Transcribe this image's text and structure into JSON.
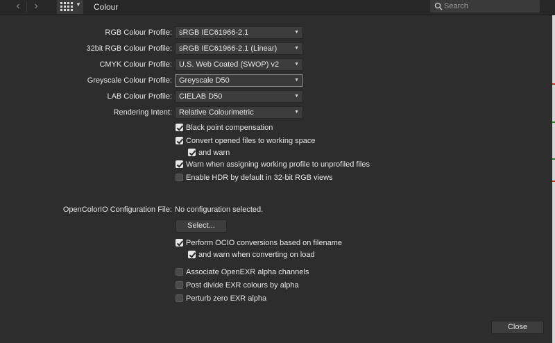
{
  "titlebar": {
    "title": "Colour",
    "search_placeholder": "Search",
    "back_icon": "chevron-left",
    "forward_icon": "chevron-right",
    "grid_icon": "grid-view"
  },
  "profiles": [
    {
      "label": "RGB Colour Profile:",
      "value": "sRGB IEC61966-2.1"
    },
    {
      "label": "32bit RGB Colour Profile:",
      "value": "sRGB IEC61966-2.1 (Linear)"
    },
    {
      "label": "CMYK Colour Profile:",
      "value": "U.S. Web Coated (SWOP) v2"
    },
    {
      "label": "Greyscale Colour Profile:",
      "value": "Greyscale D50"
    },
    {
      "label": "LAB Colour Profile:",
      "value": "CIELAB D50"
    },
    {
      "label": "Rendering Intent:",
      "value": "Relative Colourimetric"
    }
  ],
  "checks": [
    {
      "label": "Black point compensation",
      "checked": true
    },
    {
      "label": "Convert opened files to working space",
      "checked": true
    },
    {
      "label": "and warn",
      "checked": true
    },
    {
      "label": "Warn when assigning working profile to unprofiled files",
      "checked": true
    },
    {
      "label": "Enable HDR by default in 32-bit RGB views",
      "checked": false
    }
  ],
  "ocio": {
    "label": "OpenColorIO Configuration File:",
    "value": "No configuration selected.",
    "select_button": "Select...",
    "checks": [
      {
        "label": "Perform OCIO conversions based on filename",
        "checked": true
      },
      {
        "label": "and warn when converting on load",
        "checked": true
      },
      {
        "label": "Associate OpenEXR alpha channels",
        "checked": false
      },
      {
        "label": "Post divide EXR colours by alpha",
        "checked": false
      },
      {
        "label": "Perturb zero EXR alpha",
        "checked": false
      }
    ]
  },
  "footer": {
    "close_button": "Close"
  },
  "colors": {
    "background": "#2d2d2d",
    "titlebar": "#272727",
    "control": "#3c3c3c",
    "text": "#e6e6e6"
  }
}
